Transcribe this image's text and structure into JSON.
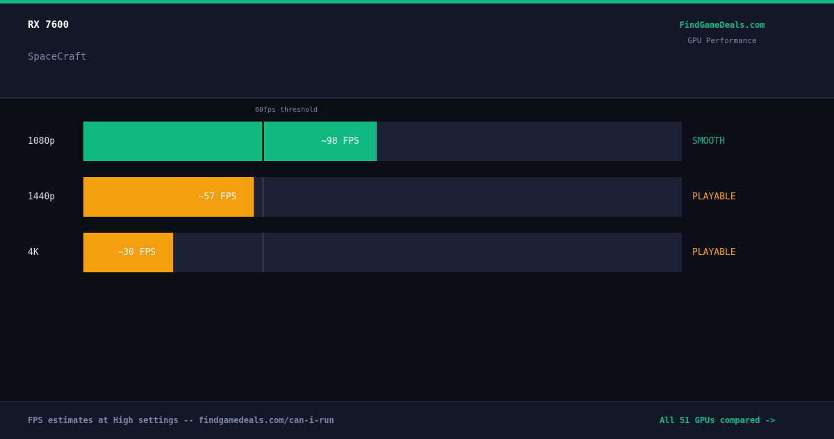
{
  "header": {
    "gpu": "RX 7600",
    "game": "SpaceCraft",
    "brand": "FindGameDeals.com",
    "subtitle": "GPU Performance"
  },
  "colors": {
    "smooth": "#10b981",
    "playable": "#f59e0b",
    "track": "#1b2235",
    "threshold": "#2a3347"
  },
  "chart_data": {
    "type": "bar",
    "orientation": "horizontal",
    "categories": [
      "1080p",
      "1440p",
      "4K"
    ],
    "values": [
      98,
      57,
      30
    ],
    "value_labels": [
      "~98 FPS",
      "~57 FPS",
      "~30 FPS"
    ],
    "status": [
      "SMOOTH",
      "PLAYABLE",
      "PLAYABLE"
    ],
    "xlim": [
      0,
      200
    ],
    "threshold": {
      "value": 60,
      "label": "60fps threshold"
    }
  },
  "footer": {
    "note": "FPS estimates at High settings -- findgamedeals.com/can-i-run",
    "link": "All 51 GPUs compared ->"
  }
}
